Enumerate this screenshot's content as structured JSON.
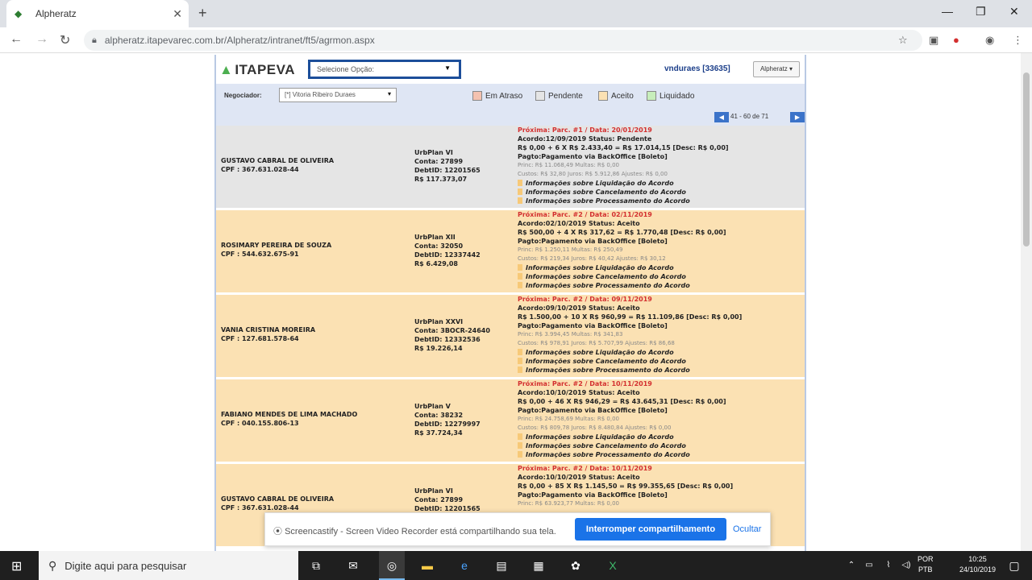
{
  "browser": {
    "tab_title": "Alpheratz",
    "url": "alpheratz.itapevarec.com.br/Alpheratz/intranet/ft5/agrmon.aspx"
  },
  "app": {
    "logo_text": "ITAPEVA",
    "main_select": "Selecione Opção:",
    "user": "vnduraes [33635]",
    "user_button": "Alpheratz",
    "negotiator_label": "Negociador:",
    "negotiator_value": "[*] Vitoria Ribeiro Duraes",
    "legend": [
      {
        "label": "Em Atraso",
        "color": "#f4c2b0"
      },
      {
        "label": "Pendente",
        "color": "#e5e5e5"
      },
      {
        "label": "Aceito",
        "color": "#fbe1b3"
      },
      {
        "label": "Liquidado",
        "color": "#c7eebb"
      }
    ],
    "pager_text": "41 - 60 de 71",
    "rows": [
      {
        "status": "pend",
        "name": "GUSTAVO CABRAL DE OLIVEIRA",
        "cpf": "CPF : 367.631.028-44",
        "plan": "UrbPlan VI",
        "conta": "Conta: 27899",
        "debtid": "DebtID: 12201565",
        "valor": "R$ 117.373,07",
        "proxima": "Próxima: Parc. #1 / Data: 20/01/2019",
        "acordo": "Acordo:12/09/2019  Status: Pendente",
        "calc": "R$ 0,00 + 6 X R$ 2.433,40 = R$ 17.014,15 [Desc: R$ 0,00]",
        "pagto": "Pagto:Pagamento via BackOffice [Boleto]",
        "princ": "Princ: R$ 11.068,49 Multas: R$ 0,00",
        "custos": "Custos: R$ 32,80 Juros: R$ 5.912,86 Ajustes: R$ 0,00",
        "info1": "Informações sobre Liquidação do Acordo",
        "info2": "Informações sobre Cancelamento do Acordo",
        "info3": "Informações sobre Processamento do Acordo"
      },
      {
        "status": "acc",
        "name": "ROSIMARY PEREIRA DE SOUZA",
        "cpf": "CPF : 544.632.675-91",
        "plan": "UrbPlan XII",
        "conta": "Conta: 32050",
        "debtid": "DebtID: 12337442",
        "valor": "R$ 6.429,08",
        "proxima": "Próxima: Parc. #2 / Data: 02/11/2019",
        "acordo": "Acordo:02/10/2019  Status: Aceito",
        "calc": "R$ 500,00 + 4 X R$ 317,62 = R$ 1.770,48 [Desc: R$ 0,00]",
        "pagto": "Pagto:Pagamento via BackOffice [Boleto]",
        "princ": "Princ: R$ 1.250,11 Multas: R$ 250,49",
        "custos": "Custos: R$ 219,34 Juros: R$ 40,42 Ajustes: R$ 30,12",
        "info1": "Informações sobre Liquidação do Acordo",
        "info2": "Informações sobre Cancelamento do Acordo",
        "info3": "Informações sobre Processamento do Acordo"
      },
      {
        "status": "acc",
        "name": "VANIA CRISTINA MOREIRA",
        "cpf": "CPF : 127.681.578-64",
        "plan": "UrbPlan XXVI",
        "conta": "Conta: 3BOCR-24640",
        "debtid": "DebtID: 12332536",
        "valor": "R$ 19.226,14",
        "proxima": "Próxima: Parc. #2 / Data: 09/11/2019",
        "acordo": "Acordo:09/10/2019  Status: Aceito",
        "calc": "R$ 1.500,00 + 10 X R$ 960,99 = R$ 11.109,86 [Desc: R$ 0,00]",
        "pagto": "Pagto:Pagamento via BackOffice [Boleto]",
        "princ": "Princ: R$ 3.994,45 Multas: R$ 341,83",
        "custos": "Custos: R$ 978,91 Juros: R$ 5.707,99 Ajustes: R$ 86,68",
        "info1": "Informações sobre Liquidação do Acordo",
        "info2": "Informações sobre Cancelamento do Acordo",
        "info3": "Informações sobre Processamento do Acordo"
      },
      {
        "status": "acc",
        "name": "FABIANO MENDES DE LIMA MACHADO",
        "cpf": "CPF : 040.155.806-13",
        "plan": "UrbPlan V",
        "conta": "Conta: 38232",
        "debtid": "DebtID: 12279997",
        "valor": "R$ 37.724,34",
        "proxima": "Próxima: Parc. #2 / Data: 10/11/2019",
        "acordo": "Acordo:10/10/2019  Status: Aceito",
        "calc": "R$ 0,00 + 46 X R$ 946,29 = R$ 43.645,31 [Desc: R$ 0,00]",
        "pagto": "Pagto:Pagamento via BackOffice [Boleto]",
        "princ": "Princ: R$ 24.758,69 Multas: R$ 0,00",
        "custos": "Custos: R$ 809,78 Juros: R$ 8.480,84 Ajustes: R$ 0,00",
        "info1": "Informações sobre Liquidação do Acordo",
        "info2": "Informações sobre Cancelamento do Acordo",
        "info3": "Informações sobre Processamento do Acordo"
      },
      {
        "status": "acc",
        "name": "GUSTAVO CABRAL DE OLIVEIRA",
        "cpf": "CPF : 367.631.028-44",
        "plan": "UrbPlan VI",
        "conta": "Conta: 27899",
        "debtid": "DebtID: 12201565",
        "valor": "",
        "proxima": "Próxima: Parc. #2 / Data: 10/11/2019",
        "acordo": "Acordo:10/10/2019  Status: Aceito",
        "calc": "R$ 0,00 + 85 X R$ 1.145,50 = R$ 99.355,65 [Desc: R$ 0,00]",
        "pagto": "Pagto:Pagamento via BackOffice [Boleto]",
        "princ": "Princ: R$ 63.923,77 Multas: R$ 0,00",
        "custos": "",
        "info1": "",
        "info2": "",
        "info3": ""
      }
    ]
  },
  "notification": {
    "message": "Screencastify - Screen Video Recorder está compartilhando sua tela.",
    "stop_button": "Interromper compartilhamento",
    "hide_button": "Ocultar"
  },
  "taskbar": {
    "search_placeholder": "Digite aqui para pesquisar",
    "lang_top": "POR",
    "lang_bottom": "PTB",
    "time": "10:25",
    "date": "24/10/2019"
  }
}
